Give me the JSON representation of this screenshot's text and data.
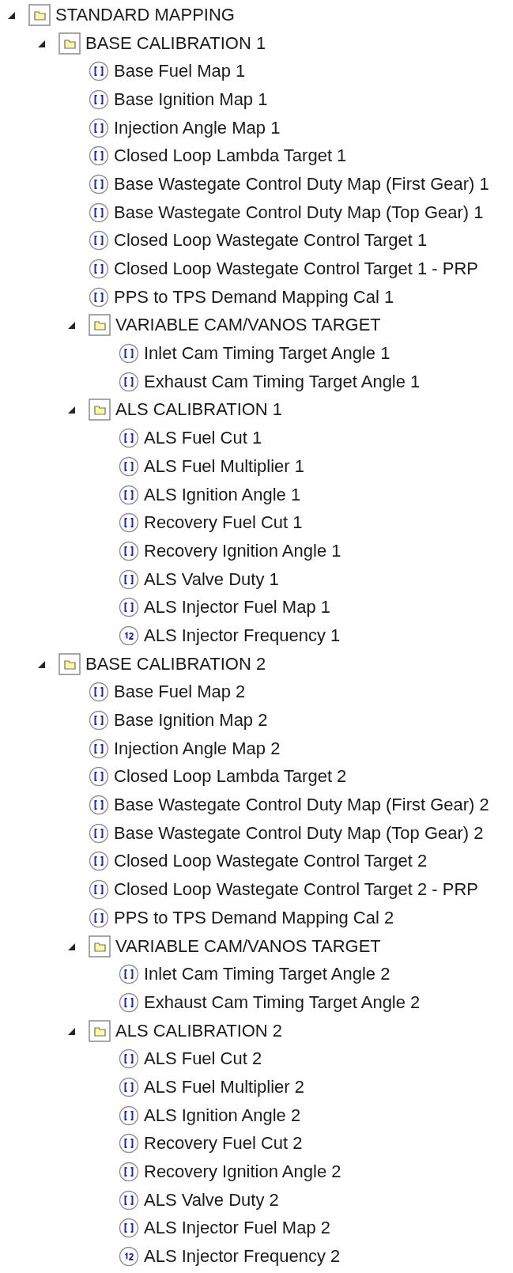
{
  "tree": [
    {
      "kind": "folder",
      "label": "STANDARD MAPPING",
      "expanded": true,
      "children": [
        {
          "kind": "folder",
          "label": "BASE CALIBRATION 1",
          "expanded": true,
          "children": [
            {
              "kind": "map",
              "label": "Base Fuel Map 1"
            },
            {
              "kind": "map",
              "label": "Base Ignition Map 1"
            },
            {
              "kind": "map",
              "label": "Injection Angle Map 1"
            },
            {
              "kind": "map",
              "label": "Closed Loop Lambda Target 1"
            },
            {
              "kind": "map",
              "label": "Base Wastegate Control Duty Map (First Gear) 1"
            },
            {
              "kind": "map",
              "label": "Base Wastegate Control Duty Map (Top Gear) 1"
            },
            {
              "kind": "map",
              "label": "Closed Loop Wastegate Control Target 1"
            },
            {
              "kind": "map",
              "label": "Closed Loop Wastegate Control Target 1 - PRP"
            },
            {
              "kind": "map",
              "label": "PPS to TPS Demand Mapping Cal 1"
            },
            {
              "kind": "folder",
              "label": "VARIABLE CAM/VANOS TARGET",
              "expanded": true,
              "children": [
                {
                  "kind": "map",
                  "label": "Inlet Cam Timing Target Angle 1"
                },
                {
                  "kind": "map",
                  "label": "Exhaust Cam Timing Target Angle 1"
                }
              ]
            },
            {
              "kind": "folder",
              "label": "ALS CALIBRATION 1",
              "expanded": true,
              "children": [
                {
                  "kind": "map",
                  "label": "ALS Fuel Cut 1"
                },
                {
                  "kind": "map",
                  "label": "ALS Fuel Multiplier 1"
                },
                {
                  "kind": "map",
                  "label": "ALS Ignition Angle 1"
                },
                {
                  "kind": "map",
                  "label": "Recovery Fuel Cut 1"
                },
                {
                  "kind": "map",
                  "label": "Recovery Ignition Angle 1"
                },
                {
                  "kind": "map",
                  "label": "ALS Valve Duty 1"
                },
                {
                  "kind": "map",
                  "label": "ALS Injector Fuel Map 1"
                },
                {
                  "kind": "value",
                  "label": "ALS Injector Frequency 1"
                }
              ]
            }
          ]
        },
        {
          "kind": "folder",
          "label": "BASE CALIBRATION 2",
          "expanded": true,
          "children": [
            {
              "kind": "map",
              "label": "Base Fuel Map 2"
            },
            {
              "kind": "map",
              "label": "Base Ignition Map 2"
            },
            {
              "kind": "map",
              "label": "Injection Angle Map 2"
            },
            {
              "kind": "map",
              "label": "Closed Loop Lambda Target 2"
            },
            {
              "kind": "map",
              "label": "Base Wastegate Control Duty Map (First Gear) 2"
            },
            {
              "kind": "map",
              "label": "Base Wastegate Control Duty Map (Top Gear) 2"
            },
            {
              "kind": "map",
              "label": "Closed Loop Wastegate Control Target 2"
            },
            {
              "kind": "map",
              "label": "Closed Loop Wastegate Control Target 2 - PRP"
            },
            {
              "kind": "map",
              "label": "PPS to TPS Demand Mapping Cal 2"
            },
            {
              "kind": "folder",
              "label": "VARIABLE CAM/VANOS TARGET",
              "expanded": true,
              "children": [
                {
                  "kind": "map",
                  "label": "Inlet Cam Timing Target Angle 2"
                },
                {
                  "kind": "map",
                  "label": "Exhaust Cam Timing Target Angle 2"
                }
              ]
            },
            {
              "kind": "folder",
              "label": "ALS CALIBRATION 2",
              "expanded": true,
              "children": [
                {
                  "kind": "map",
                  "label": "ALS Fuel Cut 2"
                },
                {
                  "kind": "map",
                  "label": "ALS Fuel Multiplier 2"
                },
                {
                  "kind": "map",
                  "label": "ALS Ignition Angle 2"
                },
                {
                  "kind": "map",
                  "label": "Recovery Fuel Cut 2"
                },
                {
                  "kind": "map",
                  "label": "Recovery Ignition Angle 2"
                },
                {
                  "kind": "map",
                  "label": "ALS Valve Duty 2"
                },
                {
                  "kind": "map",
                  "label": "ALS Injector Fuel Map 2"
                },
                {
                  "kind": "value",
                  "label": "ALS Injector Frequency 2"
                }
              ]
            }
          ]
        }
      ]
    }
  ]
}
